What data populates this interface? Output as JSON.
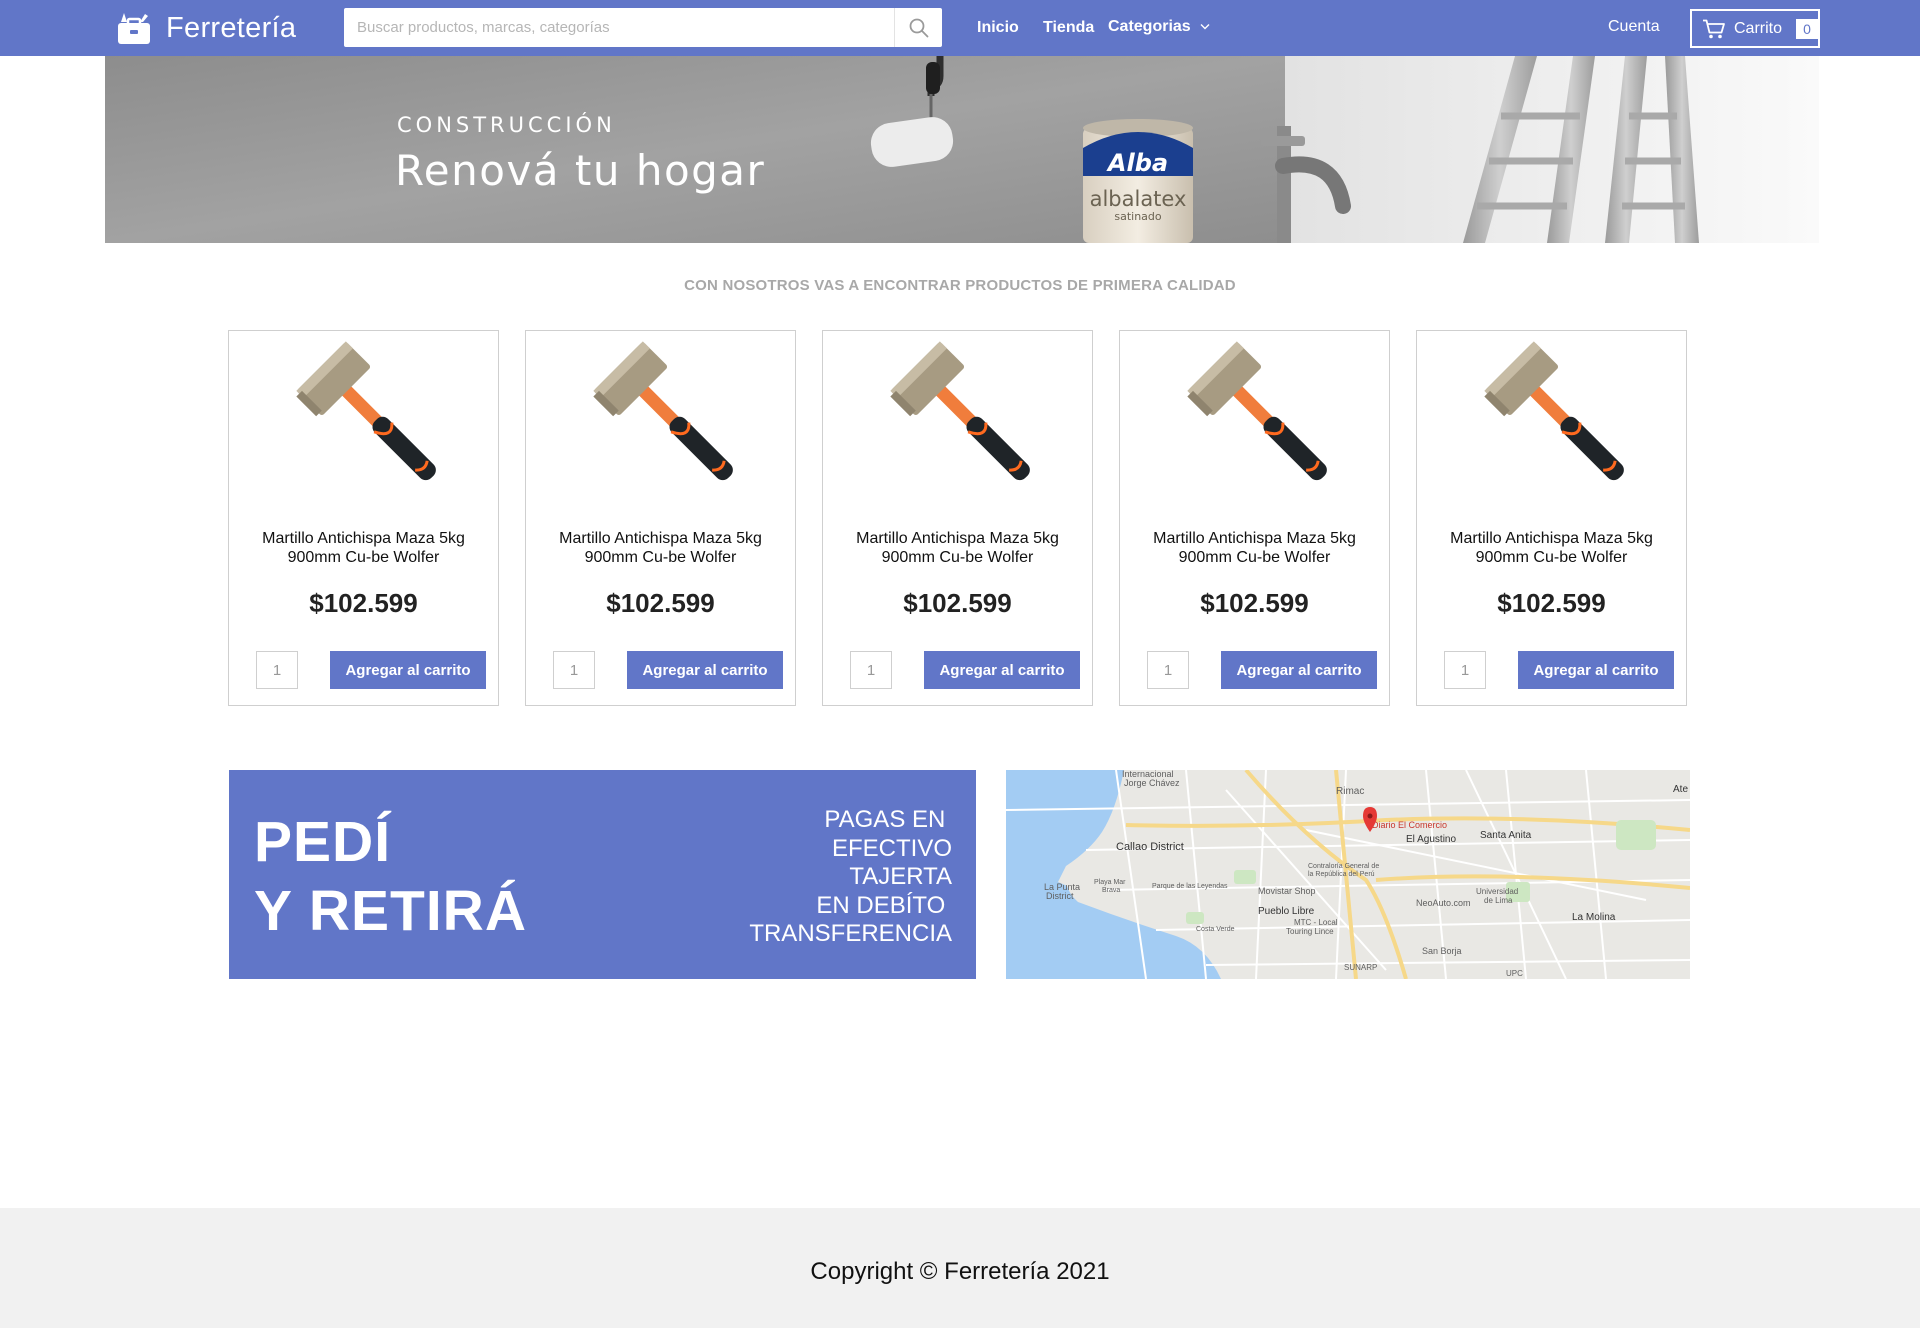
{
  "navbar": {
    "brand": "Ferretería",
    "search_placeholder": "Buscar productos, marcas, categorías",
    "links": [
      {
        "label": "Inicio"
      },
      {
        "label": "Tienda"
      },
      {
        "label": "Categorias"
      }
    ],
    "account_label": "Cuenta",
    "cart_label": "Carrito",
    "cart_count": "0"
  },
  "hero": {
    "kicker": "CONSTRUCCIÓN",
    "title": "Renová tu hogar",
    "paint_brand": "Alba",
    "paint_product": "albalatex",
    "paint_variant": "satinado"
  },
  "tagline": "CON NOSOTROS VAS A ENCONTRAR PRODUCTOS DE PRIMERA CALIDAD",
  "products": [
    {
      "name": "Martillo Antichispa Maza 5kg 900mm Cu-be Wolfer",
      "price": "$102.599",
      "qty": "1",
      "button": "Agregar al carrito"
    },
    {
      "name": "Martillo Antichispa Maza 5kg 900mm Cu-be Wolfer",
      "price": "$102.599",
      "qty": "1",
      "button": "Agregar al carrito"
    },
    {
      "name": "Martillo Antichispa Maza 5kg 900mm Cu-be Wolfer",
      "price": "$102.599",
      "qty": "1",
      "button": "Agregar al carrito"
    },
    {
      "name": "Martillo Antichispa Maza 5kg 900mm Cu-be Wolfer",
      "price": "$102.599",
      "qty": "1",
      "button": "Agregar al carrito"
    },
    {
      "name": "Martillo Antichispa Maza 5kg 900mm Cu-be Wolfer",
      "price": "$102.599",
      "qty": "1",
      "button": "Agregar al carrito"
    }
  ],
  "promo": {
    "title_line1": "PEDÍ",
    "title_line2": "Y RETIRÁ",
    "payments": [
      "PAGAS EN ",
      "EFECTIVO",
      "TAJERTA",
      "EN DEBÍTO ",
      "TRANSFERENCIA"
    ]
  },
  "map": {
    "labels": [
      "Internacional",
      "Jorge Chávez",
      "Rimac",
      "Callao District",
      "Diario El Comercio",
      "El Agustino",
      "Santa Anita",
      "La Punta",
      "District",
      "Playa Mar",
      "Brava",
      "Parque de las Leyendas",
      "Contraloría General de",
      "la República del Perú",
      "Movistar Shop",
      "NeoAuto.com",
      "Universidad",
      "de Lima",
      "Pueblo Libre",
      "MTC - Local",
      "Touring Lince",
      "La Molina",
      "Costa Verde",
      "San Borja",
      "SUNARP",
      "UPC",
      "Ate"
    ]
  },
  "footer": {
    "text": "Copyright © Ferretería 2021"
  },
  "colors": {
    "primary": "#6176c8",
    "footer_bg": "#f1f1f1",
    "tagline": "#a8a8a8"
  },
  "icons": [
    "toolbox-icon",
    "search-icon",
    "chevron-down-icon",
    "cart-icon",
    "map-pin-icon"
  ]
}
